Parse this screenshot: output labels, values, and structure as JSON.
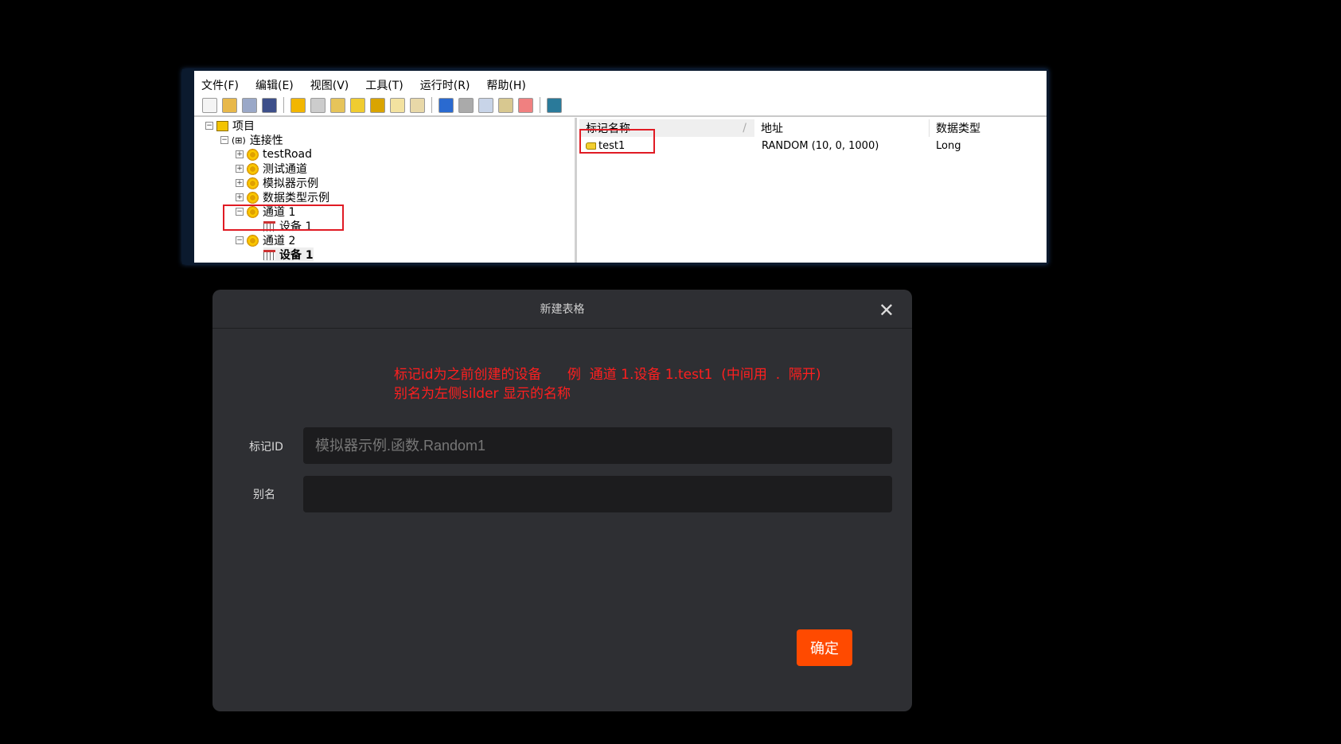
{
  "app": {
    "menu": [
      "文件(F)",
      "编辑(E)",
      "视图(V)",
      "工具(T)",
      "运行时(R)",
      "帮助(H)"
    ],
    "toolbar_icons": [
      "new-file-icon",
      "open-folder-icon",
      "save-icon",
      "save-as-icon",
      "|",
      "new-channel-icon",
      "new-device-icon",
      "new-group-icon",
      "new-tag-icon",
      "tag-config-icon",
      "tag-gray-icon",
      "import-icon",
      "|",
      "undo-icon",
      "cut-icon",
      "copy-icon",
      "paste-icon",
      "delete-icon",
      "|",
      "quick-client-icon"
    ],
    "tree": {
      "root": "项目",
      "connectivity": "连接性",
      "channels": [
        "testRoad",
        "测试通道",
        "模拟器示例",
        "数据类型示例"
      ],
      "channel1": "通道 1",
      "channel1_device": "设备 1",
      "channel2": "通道 2",
      "channel2_device": "设备 1"
    },
    "list": {
      "columns": [
        "标记名称",
        "地址",
        "数据类型"
      ],
      "sort_indicator": "/",
      "rows": [
        {
          "name": "test1",
          "address": "RANDOM (10, 0, 1000)",
          "type": "Long"
        }
      ]
    }
  },
  "dialog": {
    "title": "新建表格",
    "note_line1": "标记id为之前创建的设备      例  通道 1.设备 1.test1  (中间用  .  隔开)",
    "note_line2": "别名为左侧silder 显示的名称",
    "tag_id_label": "标记ID",
    "tag_id_placeholder": "模拟器示例.函数.Random1",
    "alias_label": "别名",
    "alias_value": "",
    "confirm": "确定"
  },
  "colors": {
    "accent": "#ff4a00",
    "annotation": "#e01b24",
    "dialog_bg": "#2e2f33"
  }
}
